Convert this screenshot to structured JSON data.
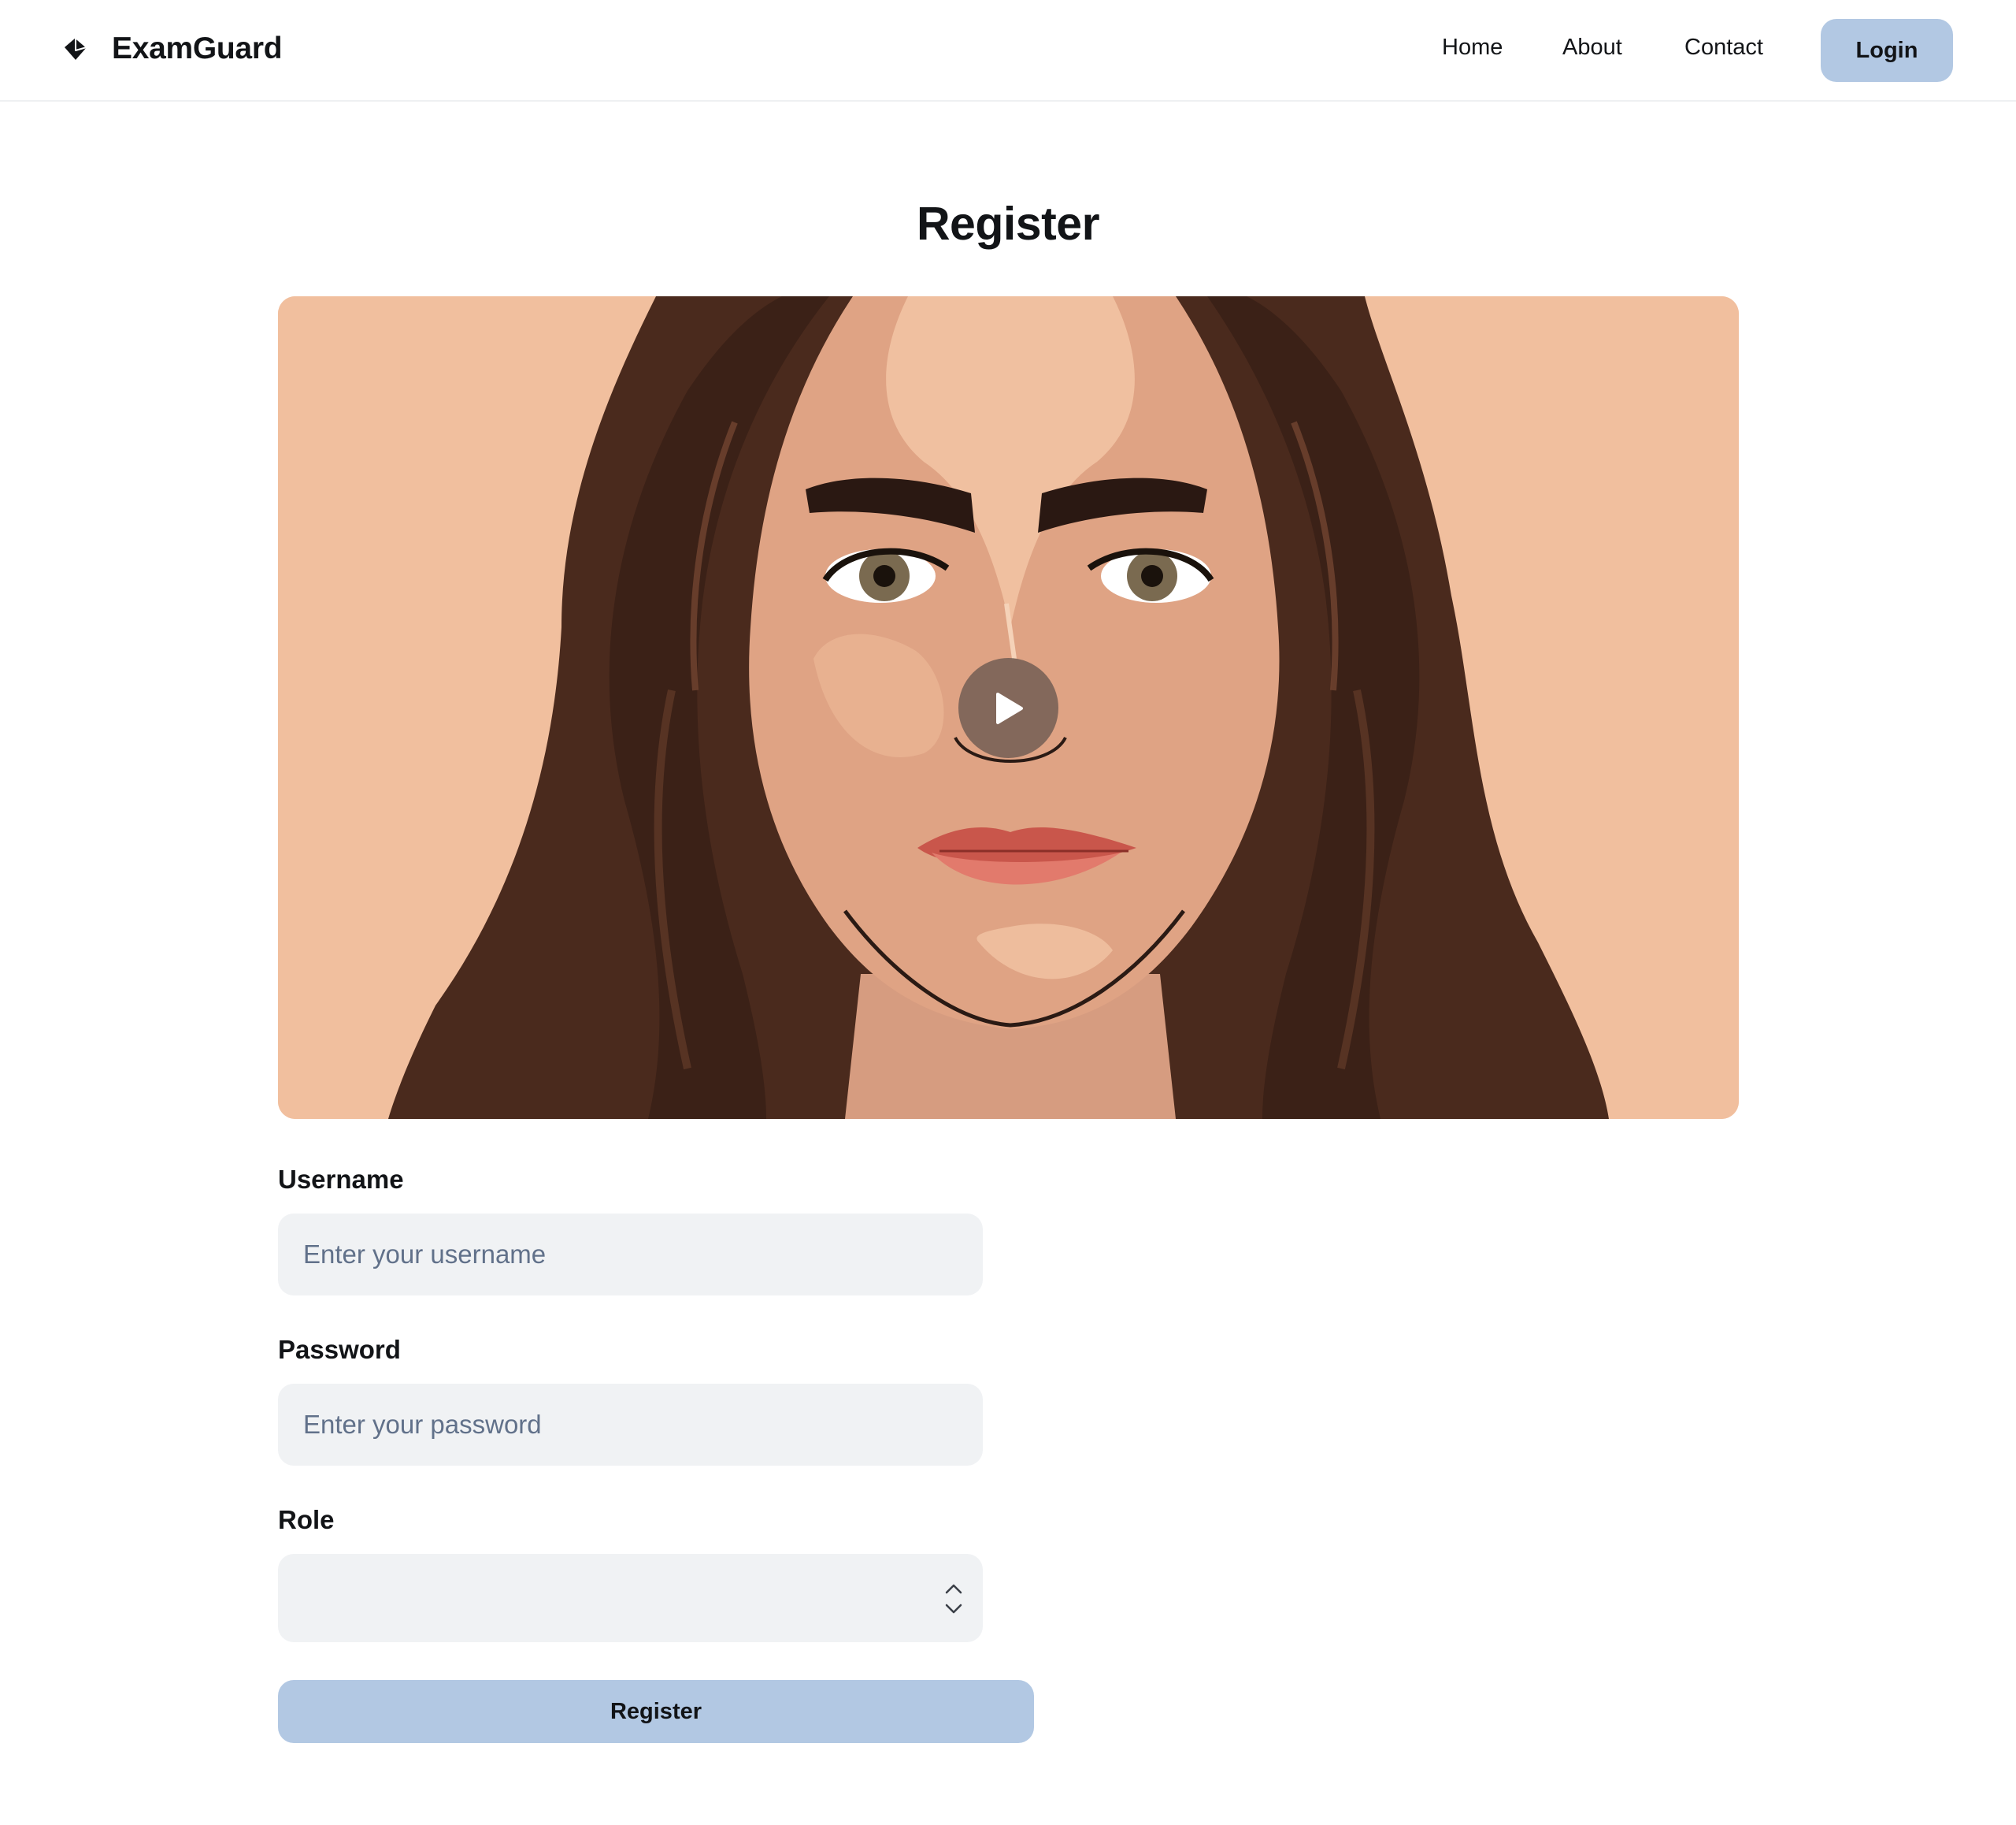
{
  "header": {
    "brand_name": "ExamGuard",
    "brand_icon": "diamond-logo-icon",
    "nav": [
      {
        "label": "Home"
      },
      {
        "label": "About"
      },
      {
        "label": "Contact"
      }
    ],
    "login_label": "Login"
  },
  "page": {
    "title": "Register"
  },
  "video": {
    "play_icon": "play-icon",
    "background_color": "#f1bf9e"
  },
  "form": {
    "username": {
      "label": "Username",
      "placeholder": "Enter your username",
      "value": ""
    },
    "password": {
      "label": "Password",
      "placeholder": "Enter your password",
      "value": ""
    },
    "role": {
      "label": "Role",
      "selected": "",
      "icon": "select-chevrons-icon"
    },
    "submit_label": "Register"
  },
  "colors": {
    "accent": "#b2c8e3",
    "input_bg": "#f0f2f4",
    "placeholder": "#61718a",
    "text": "#121417"
  }
}
